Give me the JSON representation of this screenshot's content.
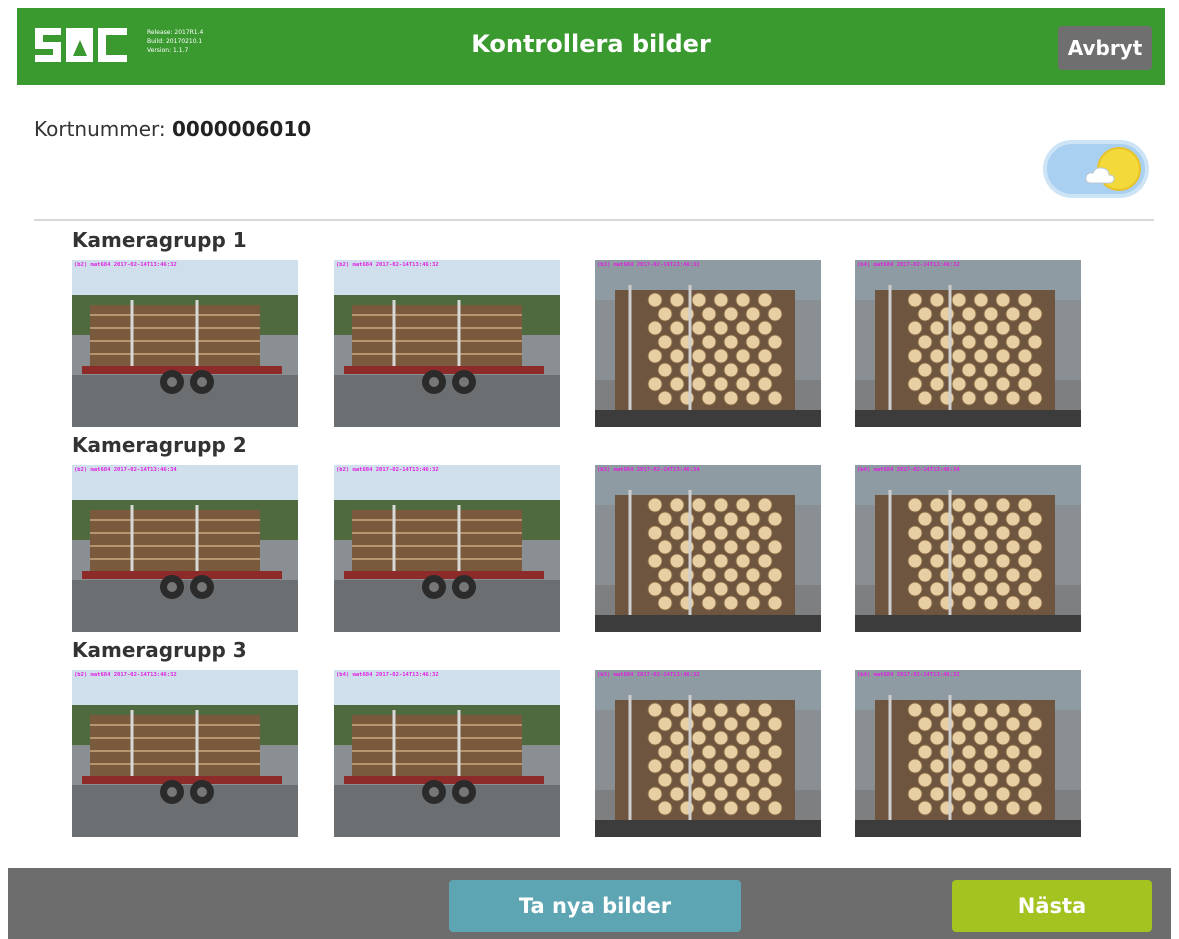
{
  "header": {
    "title": "Kontrollera bilder",
    "cancel_label": "Avbryt",
    "logo_text": "SDC",
    "build_info": [
      "Release: 2017R1.4",
      "Build: 20170210.1",
      "Version: 1.1.7"
    ]
  },
  "card": {
    "label": "Kortnummer: ",
    "number": "0000006010"
  },
  "weather_toggle": {
    "icon": "sun-cloud-icon",
    "state": "on"
  },
  "groups": [
    {
      "title": "Kameragrupp 1",
      "stamps": [
        "(b2) mat684 2017-02-14T13:46:32",
        "(b2) mat684 2017-02-14T13:46:32",
        "(b3) mat684 2017-02-14T13:46:32",
        "(b4) mat684 2017-02-14T13:46:32"
      ]
    },
    {
      "title": "Kameragrupp 2",
      "stamps": [
        "(b2) mat684 2017-02-14T13:46:34",
        "(b2) mat684 2017-02-14T13:46:32",
        "(b3) mat684 2017-02-14T13:46:34",
        "(b4) mat684 2017-02-14T13:46:34"
      ]
    },
    {
      "title": "Kameragrupp 3",
      "stamps": [
        "(b2) mat684 2017-02-14T13:46:32",
        "(b4) mat684 2017-02-14T13:46:32",
        "(b3) mat684 2017-02-14T13:46:32",
        "(b4) mat684 2017-02-14T13:46:32"
      ]
    }
  ],
  "footer": {
    "retake_label": "Ta nya bilder",
    "next_label": "Nästa"
  },
  "colors": {
    "header_green": "#3a9a30",
    "cancel_gray": "#6f6f6f",
    "retake_blue": "#5ea5b3",
    "next_green": "#a2c320",
    "stamp_magenta": "#e21ee2"
  }
}
